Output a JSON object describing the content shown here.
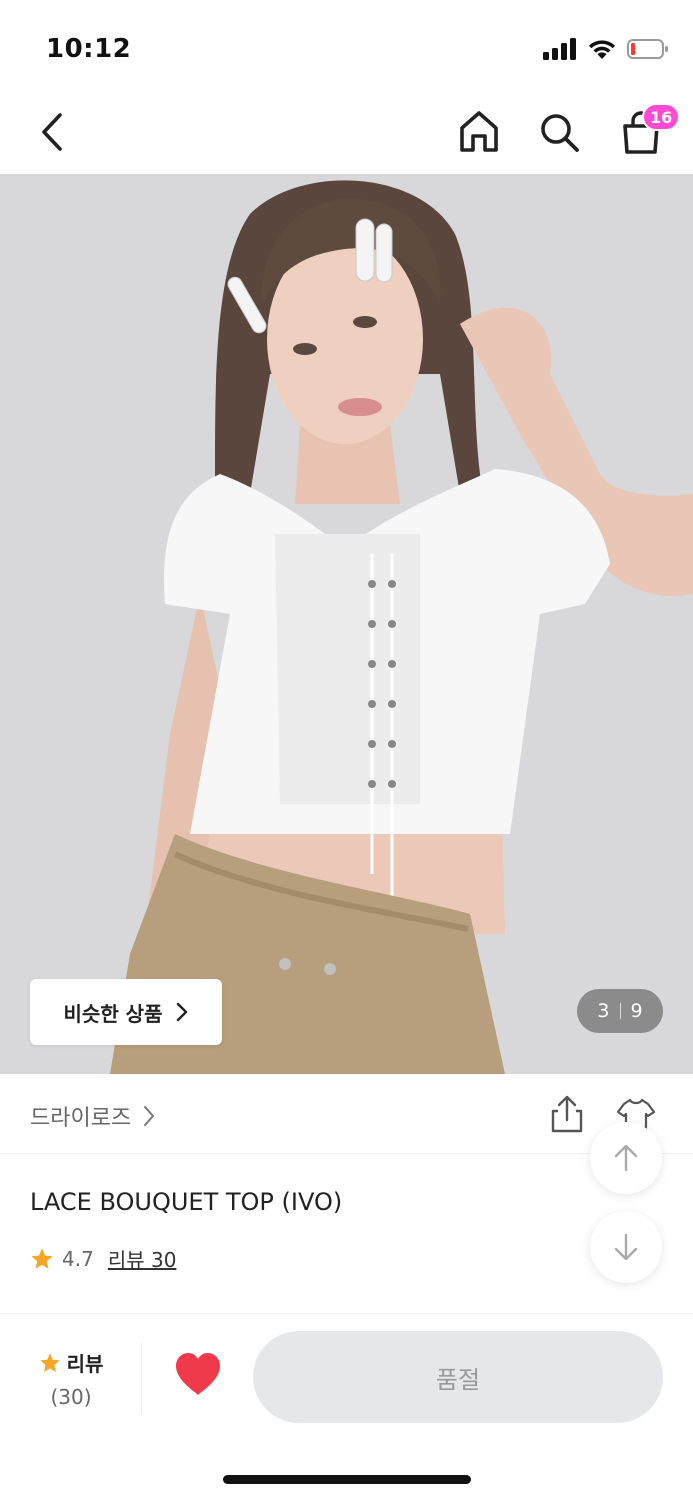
{
  "status_bar": {
    "time": "10:12",
    "icons": [
      "signal-icon",
      "wifi-icon",
      "battery-icon"
    ]
  },
  "nav": {
    "back_icon": "chevron-left-icon",
    "home_icon": "home-icon",
    "search_icon": "search-icon",
    "cart_icon": "shopping-bag-icon",
    "cart_count": "16",
    "badge_color": "#ff4bd3"
  },
  "hero": {
    "similar_button_label": "비슷한 상품",
    "current_page": "3",
    "total_pages": "9"
  },
  "brand": {
    "name": "드라이로즈",
    "share_icon": "share-icon",
    "hanger_icon": "hanger-icon"
  },
  "product": {
    "title": "LACE BOUQUET TOP (IVO)",
    "rating": "4.7",
    "review_link": "리뷰 30",
    "star_color": "#f5a623"
  },
  "scroll": {
    "up_icon": "arrow-up-icon",
    "down_icon": "arrow-down-icon"
  },
  "bottom_bar": {
    "review_label": "리뷰",
    "review_count": "(30)",
    "like_color": "#f0394b",
    "soldout_label": "품절"
  }
}
